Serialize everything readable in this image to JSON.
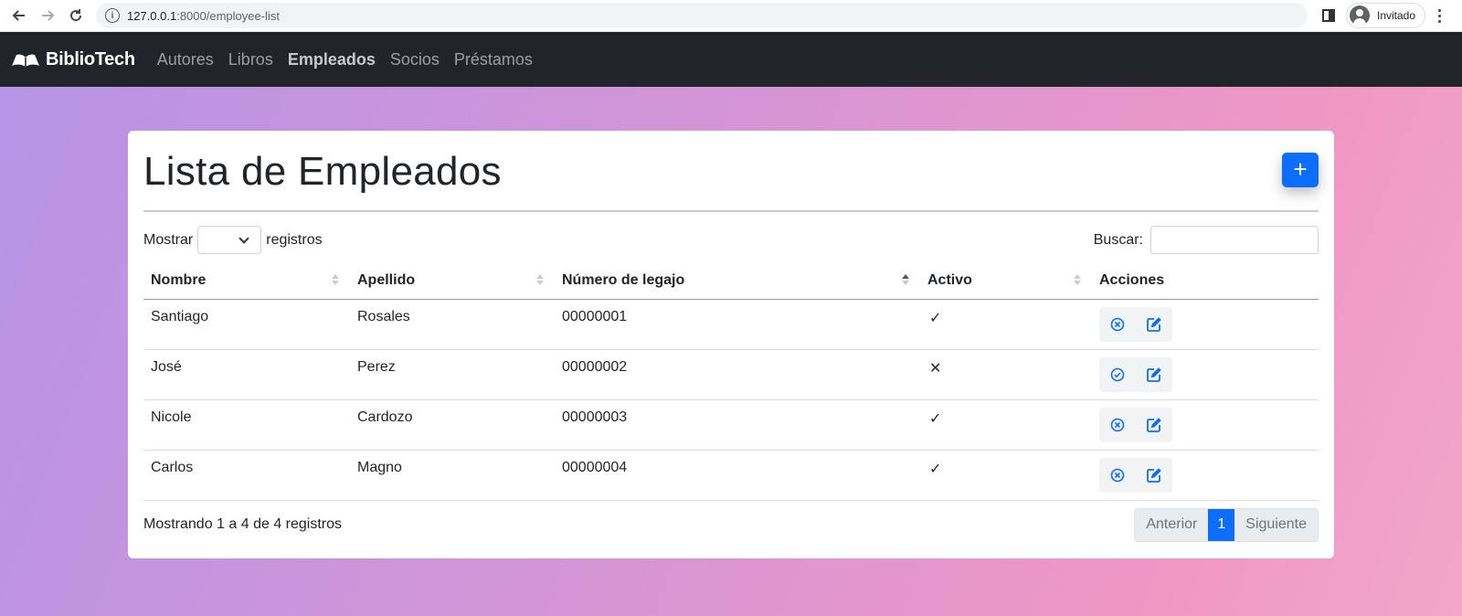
{
  "browser": {
    "url_host": "127.0.0.1",
    "url_path": ":8000/employee-list",
    "profile_label": "Invitado"
  },
  "navbar": {
    "brand": "BiblioTech",
    "links": [
      {
        "label": "Autores"
      },
      {
        "label": "Libros"
      },
      {
        "label": "Empleados",
        "active": true
      },
      {
        "label": "Socios"
      },
      {
        "label": "Préstamos"
      }
    ]
  },
  "card": {
    "title": "Lista de Empleados",
    "add_label": "+"
  },
  "table_controls": {
    "show_prefix": "Mostrar",
    "show_suffix": "registros",
    "search_label": "Buscar:"
  },
  "table": {
    "columns": [
      "Nombre",
      "Apellido",
      "Número de legajo",
      "Activo",
      "Acciones"
    ],
    "rows": [
      {
        "nombre": "Santiago",
        "apellido": "Rosales",
        "legajo": "00000001",
        "activo": "✓",
        "toggle": "deactivate"
      },
      {
        "nombre": "José",
        "apellido": "Perez",
        "legajo": "00000002",
        "activo": "✕",
        "toggle": "activate"
      },
      {
        "nombre": "Nicole",
        "apellido": "Cardozo",
        "legajo": "00000003",
        "activo": "✓",
        "toggle": "deactivate"
      },
      {
        "nombre": "Carlos",
        "apellido": "Magno",
        "legajo": "00000004",
        "activo": "✓",
        "toggle": "deactivate"
      }
    ]
  },
  "footer": {
    "info": "Mostrando 1 a 4 de 4 registros",
    "prev": "Anterior",
    "page": "1",
    "next": "Siguiente"
  },
  "colors": {
    "primary": "#0d6efd",
    "navbar_bg": "#212529"
  }
}
